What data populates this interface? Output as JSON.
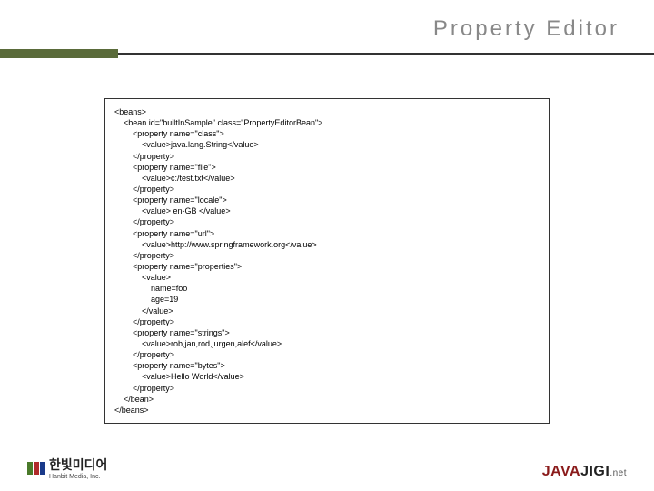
{
  "title": "Property Editor",
  "code": "<beans>\n    <bean id=\"builtInSample\" class=\"PropertyEditorBean\">\n        <property name=\"class\">\n            <value>java.lang.String</value>\n        </property>\n        <property name=\"file\">\n            <value>c:/test.txt</value>\n        </property>\n        <property name=\"locale\">\n            <value> en-GB </value>\n        </property>\n        <property name=\"url\">\n            <value>http://www.springframework.org</value>\n        </property>\n        <property name=\"properties\">\n            <value>\n                name=foo\n                age=19\n            </value>\n        </property>\n        <property name=\"strings\">\n            <value>rob,jan,rod,jurgen,alef</value>\n        </property>\n        <property name=\"bytes\">\n            <value>Hello World</value>\n        </property>\n    </bean>\n</beans>",
  "footer": {
    "left_brand": "한빛미디어",
    "left_sub": "Hanbit Media, Inc.",
    "right_java": "JAVA",
    "right_jigi": "JIGI",
    "right_net": ".net"
  }
}
